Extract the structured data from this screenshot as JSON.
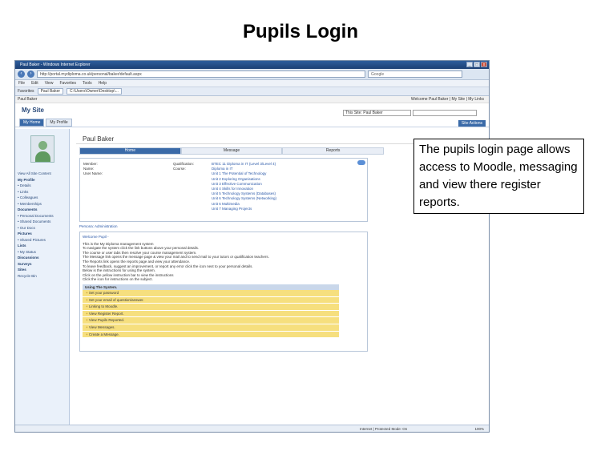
{
  "slide": {
    "title": "Pupils Login",
    "callout": "The pupils login page allows access to Moodle, messaging and view there register reports."
  },
  "browser": {
    "window_title": "Paul Baker - Windows Internet Explorer",
    "url": "http://portal.mydiploma.co.uk/personal/baker/default.aspx",
    "search_placeholder": "Google",
    "menus": [
      "File",
      "Edit",
      "View",
      "Favorites",
      "Tools",
      "Help"
    ],
    "favorites_label": "Favorites",
    "tabs": [
      "Paul Baker",
      "C:\\Users\\Owner\\Desktop\\..."
    ],
    "status_zone": "Internet | Protected Mode: On",
    "zoom": "100%"
  },
  "sharepoint": {
    "breadcrumb": "Paul Baker",
    "welcome": "Welcome Paul Baker  |  My Site  |  My Links",
    "site_title": "My Site",
    "site_tabs": [
      "My Home",
      "My Profile"
    ],
    "scope": "This Site: Paul Baker",
    "site_actions": "Site Actions"
  },
  "leftnav": [
    {
      "label": "View All Site Content",
      "head": false
    },
    {
      "label": "My Profile",
      "head": true
    },
    {
      "label": "• Details",
      "head": false
    },
    {
      "label": "• Links",
      "head": false
    },
    {
      "label": "• Colleagues",
      "head": false
    },
    {
      "label": "• Memberships",
      "head": false
    },
    {
      "label": "Documents",
      "head": true
    },
    {
      "label": "• Personal Documents",
      "head": false
    },
    {
      "label": "• Shared Documents",
      "head": false
    },
    {
      "label": "• Our Docs",
      "head": false
    },
    {
      "label": "Pictures",
      "head": true
    },
    {
      "label": "• Shared Pictures",
      "head": false
    },
    {
      "label": "Lists",
      "head": true
    },
    {
      "label": "• My Status",
      "head": false
    },
    {
      "label": "Discussions",
      "head": true
    },
    {
      "label": "Surveys",
      "head": true
    },
    {
      "label": "Sites",
      "head": true
    },
    {
      "label": "Recycle Bin",
      "head": false
    }
  ],
  "profile": {
    "name": "Paul Baker",
    "tabs": [
      "Home",
      "Message",
      "Reports"
    ],
    "labels": [
      "Member:",
      "Name:",
      "User Name:"
    ],
    "qual_labels": [
      "Qualification:",
      "Course:"
    ],
    "units": [
      "BTEC 11 Diploma in IT (Level 3/Level 4)",
      "Diploma in IT",
      "Unit 1 The Potential of Technology",
      "Unit 2 Exploring Organisations",
      "Unit 3 Effective Communication",
      "Unit 4 Skills for Innovation",
      "Unit 5 Technology Systems (Databases)",
      "Unit 6 Technology Systems (Networking)",
      "Unit 6 Multimedia",
      "Unit 7 Managing Projects"
    ],
    "persona": "Persona: Administration"
  },
  "welcome": {
    "title": "Welcome Pupil -",
    "lines": [
      "This is the My Diploma management system",
      "To navigate the system click the link buttons above your personal details.",
      "The course or user tabs then resolve your course management system.",
      "The Message link opens the message page & view your mail and to send mail to your tutors or qualification teachers.",
      "The Reports link opens the reports page and view your attendance.",
      "To leave feedback, suggest an improvement, or report any error click the icon next to your personal details.",
      "Below is the instructions for using the system.",
      "Click on the yellow instruction bar to view the instructions",
      "Click the icon for instructions on the subject."
    ],
    "using_header": "Using The System.",
    "items": [
      "Set your password",
      "Set your email of question/answer.",
      "Linking to Moodle.",
      "View Register Report.",
      "View Pupils Reported.",
      "View Messages.",
      "Create a Message."
    ]
  }
}
